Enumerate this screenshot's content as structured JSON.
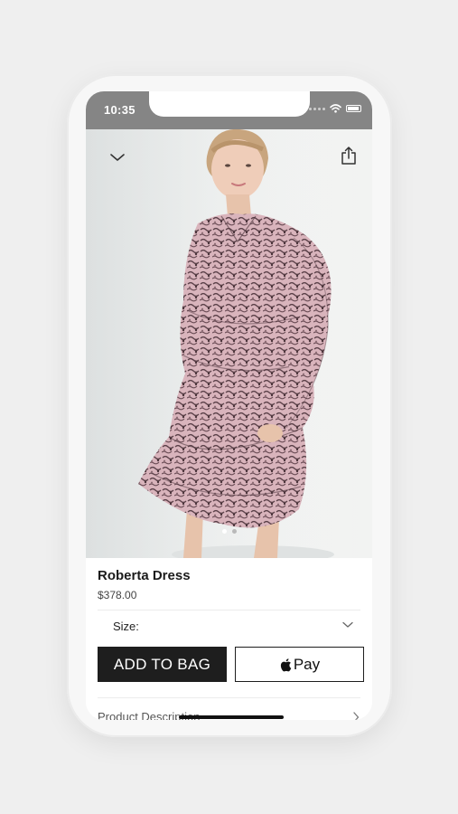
{
  "status_bar": {
    "time": "10:35",
    "icons": [
      "cellular-dots-icon",
      "wifi-icon",
      "battery-icon"
    ]
  },
  "header": {
    "collapse_icon": "chevron-down-icon",
    "share_icon": "share-icon"
  },
  "gallery": {
    "page_count": 2,
    "active_index": 0,
    "active_color": "#ffffff",
    "inactive_color": "#b9b9b9"
  },
  "product": {
    "name": "Roberta Dress",
    "price": "$378.00"
  },
  "size_selector": {
    "label": "Size:",
    "icon": "chevron-down-icon"
  },
  "actions": {
    "add_to_bag": "ADD TO BAG",
    "apple_pay_label": "Pay",
    "apple_pay_icon": "apple-logo-icon"
  },
  "details": {
    "product_description": "Product Description"
  },
  "colors": {
    "status_bar": "#858585",
    "primary_button": "#1e1e1e",
    "background": "#efefef"
  }
}
